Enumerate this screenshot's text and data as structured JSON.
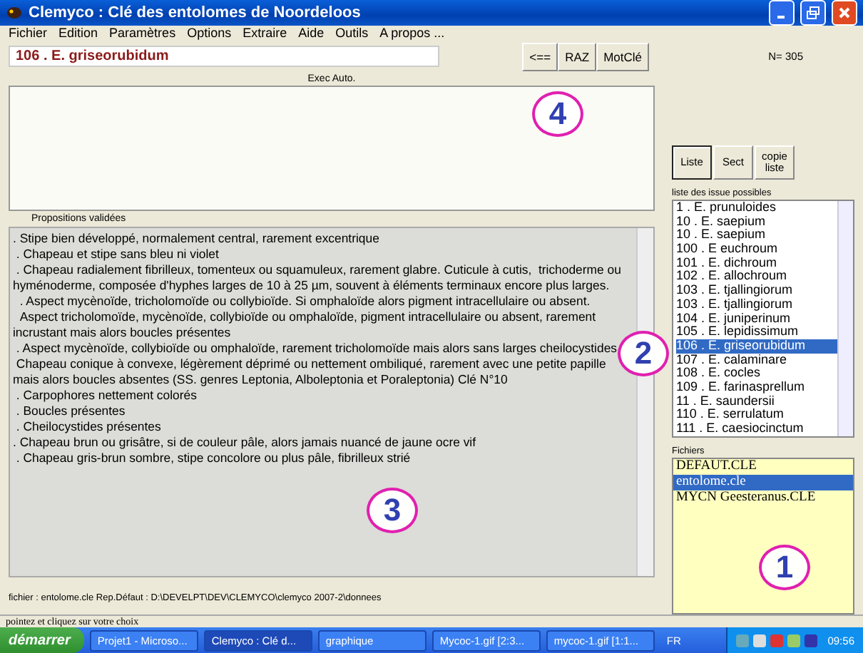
{
  "window": {
    "title": "Clemyco : Clé des entolomes de Noordeloos"
  },
  "menu": [
    "Fichier",
    "Edition",
    "Paramètres",
    "Options",
    "Extraire",
    "Aide",
    "Outils",
    "A propos ..."
  ],
  "current": {
    "value": "106 . E. griseorubidum"
  },
  "toolbar": [
    "<==",
    "RAZ",
    "MotClé"
  ],
  "exec_label": "Exec Auto.",
  "count": "N= 305",
  "right_buttons": [
    {
      "label": "Liste",
      "selected": true
    },
    {
      "label": "Sect",
      "selected": false
    },
    {
      "label": "copie liste",
      "selected": false
    }
  ],
  "propositions_label": "Propositions validées",
  "propositions": [
    ". Stipe bien développé, normalement central, rarement excentrique",
    " . Chapeau et stipe sans bleu ni violet",
    " . Chapeau radialement fibrilleux, tomenteux ou squamuleux, rarement glabre. Cuticule à cutis,  trichoderme ou hyménoderme, composée d'hyphes larges de 10 à 25 µm, souvent à éléments terminaux encore plus larges.",
    "  . Aspect mycènoïde, tricholomoïde ou collybioïde. Si omphaloïde alors pigment intracellulaire ou absent.",
    "  Aspect tricholomoïde, mycènoïde, collybioïde ou omphaloïde, pigment intracellulaire ou absent, rarement incrustant mais alors boucles présentes",
    " . Aspect mycènoïde, collybioïde ou omphaloïde, rarement tricholomoïde mais alors sans larges cheilocystides",
    " Chapeau conique à convexe, légèrement déprimé ou nettement ombiliqué, rarement avec une petite papille mais alors boucles absentes (SS. genres Leptonia, Alboleptonia et Poraleptonia) Clé N°10",
    " . Carpophores nettement colorés",
    " . Boucles présentes",
    " . Cheilocystides présentes",
    ". Chapeau brun ou grisâtre, si de couleur pâle, alors jamais nuancé de jaune ocre vif",
    " . Chapeau gris-brun sombre, stipe concolore ou plus pâle, fibrilleux strié"
  ],
  "issues_label": "liste des issue possibles",
  "issues": [
    {
      "label": "1 . E. prunuloides",
      "selected": false
    },
    {
      "label": "10 . E. saepium",
      "selected": false
    },
    {
      "label": "10 . E. saepium",
      "selected": false
    },
    {
      "label": "100 . E euchroum",
      "selected": false
    },
    {
      "label": "101 . E. dichroum",
      "selected": false
    },
    {
      "label": "102 . E. allochroum",
      "selected": false
    },
    {
      "label": "103 . E. tjallingiorum",
      "selected": false
    },
    {
      "label": "103 . E. tjallingiorum",
      "selected": false
    },
    {
      "label": "104 . E. juniperinum",
      "selected": false
    },
    {
      "label": "105 . E. lepidissimum",
      "selected": false
    },
    {
      "label": "106 . E. griseorubidum",
      "selected": true
    },
    {
      "label": "107 . E. calaminare",
      "selected": false
    },
    {
      "label": "108 . E. cocles",
      "selected": false
    },
    {
      "label": "109 . E. farinasprellum",
      "selected": false
    },
    {
      "label": "11 . E. saundersii",
      "selected": false
    },
    {
      "label": "110 . E. serrulatum",
      "selected": false
    },
    {
      "label": "111 . E. caesiocinctum",
      "selected": false
    }
  ],
  "files_label": "Fichiers",
  "files": [
    {
      "label": "DEFAUT.CLE",
      "selected": false
    },
    {
      "label": "entolome.cle",
      "selected": true
    },
    {
      "label": "MYCN Geesteranus.CLE",
      "selected": false
    }
  ],
  "footer": "fichier : entolome.cle    Rep.Défaut : D:\\DEVELPT\\DEV\\CLEMYCO\\clemyco 2007-2\\donnees",
  "status_bar": "pointez et cliquez sur votre choix",
  "callouts": [
    "1",
    "2",
    "3",
    "4"
  ],
  "taskbar": {
    "start": "démarrer",
    "tasks": [
      {
        "label": "Projet1 - Microso...",
        "selected": false
      },
      {
        "label": "Clemyco : Clé d...",
        "selected": true
      },
      {
        "label": "graphique",
        "selected": false
      },
      {
        "label": "Mycoc-1.gif [2:3...",
        "selected": false
      },
      {
        "label": "mycoc-1.gif [1:1...",
        "selected": false
      }
    ],
    "lang": "FR",
    "clock": "09:56"
  }
}
